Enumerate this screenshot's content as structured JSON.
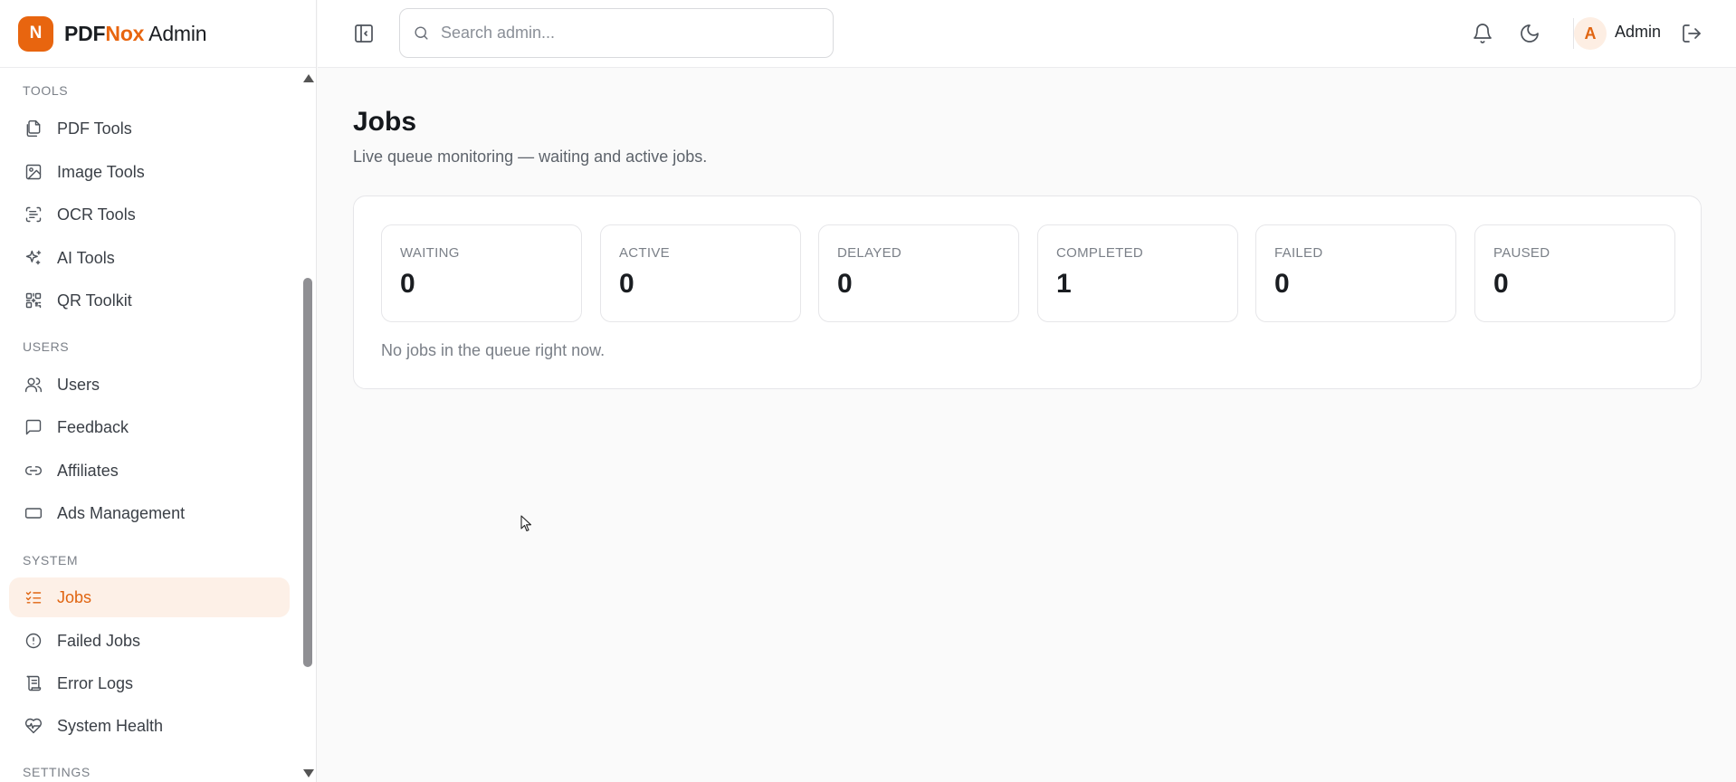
{
  "brand": {
    "logo_letter": "N",
    "name_part1": "PDF",
    "name_part2": "Nox",
    "name_part3": " Admin",
    "accent_color": "#e8650f"
  },
  "search": {
    "placeholder": "Search admin..."
  },
  "user": {
    "avatar_letter": "A",
    "name": "Admin"
  },
  "sidebar": {
    "sections": {
      "tools": "TOOLS",
      "users": "USERS",
      "system": "SYSTEM",
      "settings": "SETTINGS"
    },
    "items": [
      {
        "label": "PDF Tools",
        "icon": "files-icon"
      },
      {
        "label": "Image Tools",
        "icon": "image-icon"
      },
      {
        "label": "OCR Tools",
        "icon": "scan-text-icon"
      },
      {
        "label": "AI Tools",
        "icon": "sparkles-icon"
      },
      {
        "label": "QR Toolkit",
        "icon": "qr-code-icon"
      },
      {
        "label": "Users",
        "icon": "users-icon"
      },
      {
        "label": "Feedback",
        "icon": "message-square-icon"
      },
      {
        "label": "Affiliates",
        "icon": "link-icon"
      },
      {
        "label": "Ads Management",
        "icon": "rectangle-icon"
      },
      {
        "label": "Jobs",
        "icon": "list-checks-icon",
        "active": true
      },
      {
        "label": "Failed Jobs",
        "icon": "alert-circle-icon"
      },
      {
        "label": "Error Logs",
        "icon": "scroll-text-icon"
      },
      {
        "label": "System Health",
        "icon": "heart-pulse-icon"
      }
    ]
  },
  "page": {
    "title": "Jobs",
    "subtitle": "Live queue monitoring — waiting and active jobs.",
    "empty_message": "No jobs in the queue right now."
  },
  "stats": [
    {
      "label": "WAITING",
      "value": "0"
    },
    {
      "label": "ACTIVE",
      "value": "0"
    },
    {
      "label": "DELAYED",
      "value": "0"
    },
    {
      "label": "COMPLETED",
      "value": "1"
    },
    {
      "label": "FAILED",
      "value": "0"
    },
    {
      "label": "PAUSED",
      "value": "0"
    }
  ]
}
